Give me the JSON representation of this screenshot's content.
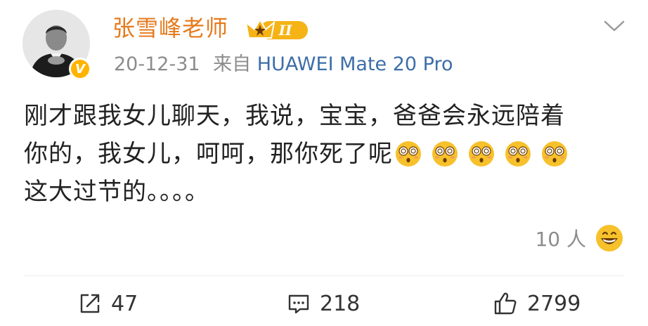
{
  "post": {
    "username": "张雪峰老师",
    "vip_level": "II",
    "verified_badge": "V",
    "date": "20-12-31",
    "source_prefix": "来自",
    "source_device": "HUAWEI Mate 20 Pro",
    "content_lines": [
      "刚才跟我女儿聊天，我说，宝宝，爸爸会永远陪着",
      "你的，我女儿，呵呵，那你死了呢",
      "这大过节的。。。。"
    ],
    "inline_emojis": [
      "flushed-face",
      "flushed-face",
      "flushed-face",
      "flushed-face",
      "flushed-face"
    ],
    "reactions_count": "10 人",
    "reaction_icon": "grinning-face"
  },
  "actions": {
    "repost": "47",
    "comment": "218",
    "like": "2799"
  },
  "colors": {
    "username": "#e67a1c",
    "source_link": "#3d6ea8",
    "meta_gray": "#8c8c8c",
    "vip_gold": "#f5b316"
  }
}
